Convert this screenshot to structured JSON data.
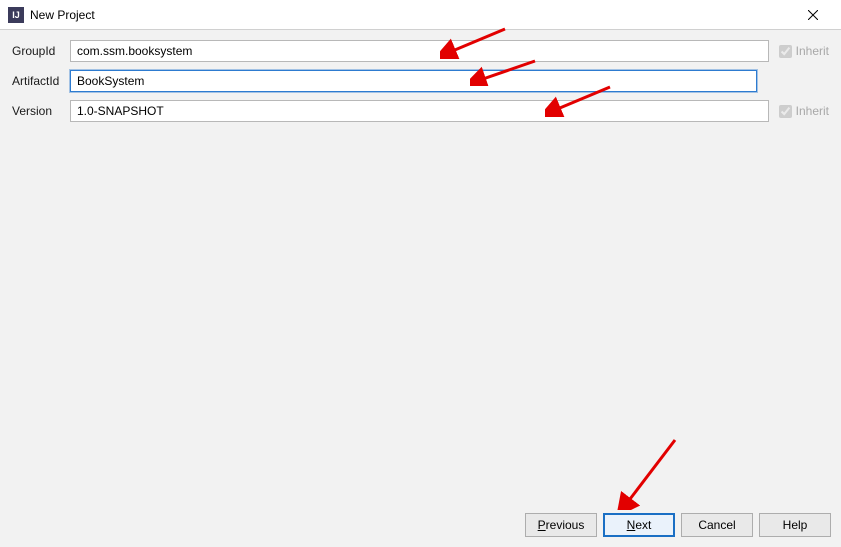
{
  "window": {
    "title": "New Project",
    "icon_letters": "IJ"
  },
  "fields": {
    "groupId": {
      "label": "GroupId",
      "value": "com.ssm.booksystem",
      "inherit_label": "Inherit",
      "inherit_checked": true
    },
    "artifactId": {
      "label": "ArtifactId",
      "value": "BookSystem"
    },
    "version": {
      "label": "Version",
      "value": "1.0-SNAPSHOT",
      "inherit_label": "Inherit",
      "inherit_checked": true
    }
  },
  "buttons": {
    "previous": {
      "mnemonic": "P",
      "rest": "revious"
    },
    "next": {
      "mnemonic": "N",
      "rest": "ext"
    },
    "cancel": {
      "label": "Cancel"
    },
    "help": {
      "label": "Help"
    }
  }
}
